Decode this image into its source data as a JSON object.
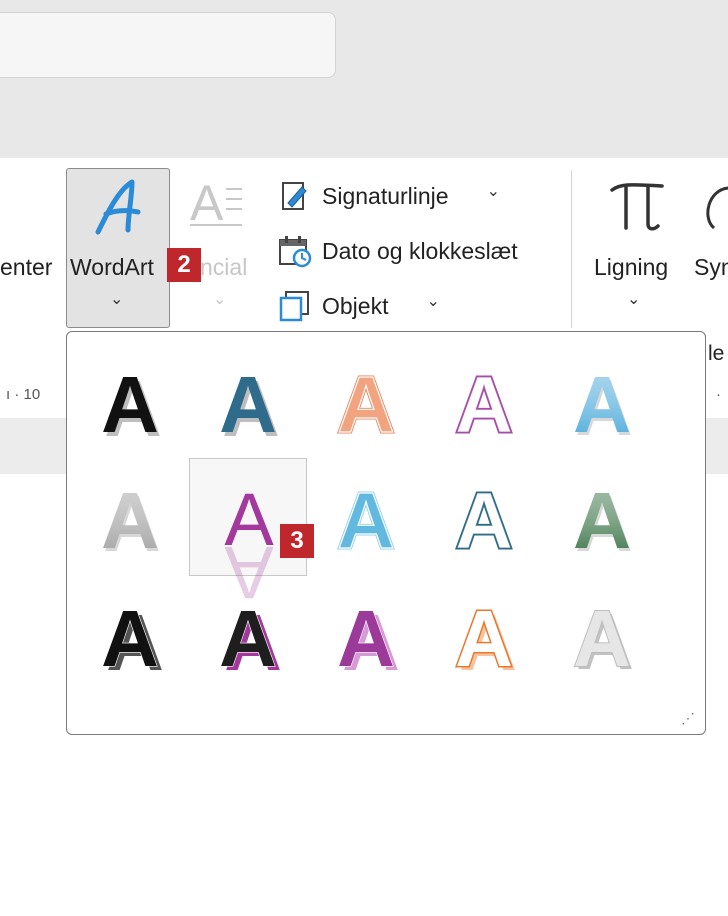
{
  "ribbon": {
    "partial_left_label": "enter",
    "wordart_label": "WordArt",
    "dropcap_label": "ncial",
    "signature_label": "Signaturlinje",
    "datetime_label": "Dato og klokkeslæt",
    "object_label": "Objekt",
    "equation_label": "Ligning",
    "symbol_label": "Syn",
    "partial_right_label": "le",
    "ruler_text": "ı · 10",
    "ruler_right": "·"
  },
  "badges": {
    "step_wordart": "2",
    "step_gallery": "3"
  },
  "wordart_gallery": {
    "glyph": "A",
    "resize_grip": "⋰",
    "styles": [
      {
        "id": "fill-black-shadow",
        "row": 1,
        "col": 1,
        "fill": "#111111",
        "outline": "none",
        "effect": "shadow"
      },
      {
        "id": "fill-blue-shadow",
        "row": 1,
        "col": 2,
        "fill": "#2f6c8c",
        "outline": "none",
        "effect": "shadow"
      },
      {
        "id": "fill-orange-outline",
        "row": 1,
        "col": 3,
        "fill": "#f2a481",
        "outline": "#e8825a",
        "effect": "inner-outline"
      },
      {
        "id": "outline-purple",
        "row": 1,
        "col": 4,
        "fill": "#ffffff",
        "outline": "#a54ba8",
        "effect": "outline"
      },
      {
        "id": "gradient-blue",
        "row": 1,
        "col": 5,
        "fill": "#3ea3d8",
        "outline": "none",
        "effect": "gradient"
      },
      {
        "id": "gradient-gray",
        "row": 2,
        "col": 1,
        "fill": "#9a9a9a",
        "outline": "none",
        "effect": "gradient"
      },
      {
        "id": "purple-reflection",
        "row": 2,
        "col": 2,
        "fill": "#a3399d",
        "outline": "none",
        "effect": "reflection",
        "selected": true
      },
      {
        "id": "light-blue-bevel",
        "row": 2,
        "col": 3,
        "fill": "#62b9e0",
        "outline": "#8fd0ec",
        "effect": "inner-outline"
      },
      {
        "id": "outline-teal",
        "row": 2,
        "col": 4,
        "fill": "#ffffff",
        "outline": "#2d6b86",
        "effect": "outline"
      },
      {
        "id": "gradient-green",
        "row": 2,
        "col": 5,
        "fill": "#2d6b3a",
        "outline": "none",
        "effect": "gradient"
      },
      {
        "id": "black-3d",
        "row": 3,
        "col": 1,
        "fill": "#111111",
        "outline": "none",
        "effect": "3d"
      },
      {
        "id": "dark-purple-3d",
        "row": 3,
        "col": 2,
        "fill": "#1e1e1e",
        "outline": "none",
        "effect": "3d-purple"
      },
      {
        "id": "purple-3d",
        "row": 3,
        "col": 3,
        "fill": "#9c3a9a",
        "outline": "none",
        "effect": "3d-light"
      },
      {
        "id": "orange-outline-3d",
        "row": 3,
        "col": 4,
        "fill": "#ffffff",
        "outline": "#e8782d",
        "effect": "outline-3d"
      },
      {
        "id": "silver-3d",
        "row": 3,
        "col": 5,
        "fill": "#e6e6e6",
        "outline": "#bdbdbd",
        "effect": "silver"
      }
    ]
  }
}
